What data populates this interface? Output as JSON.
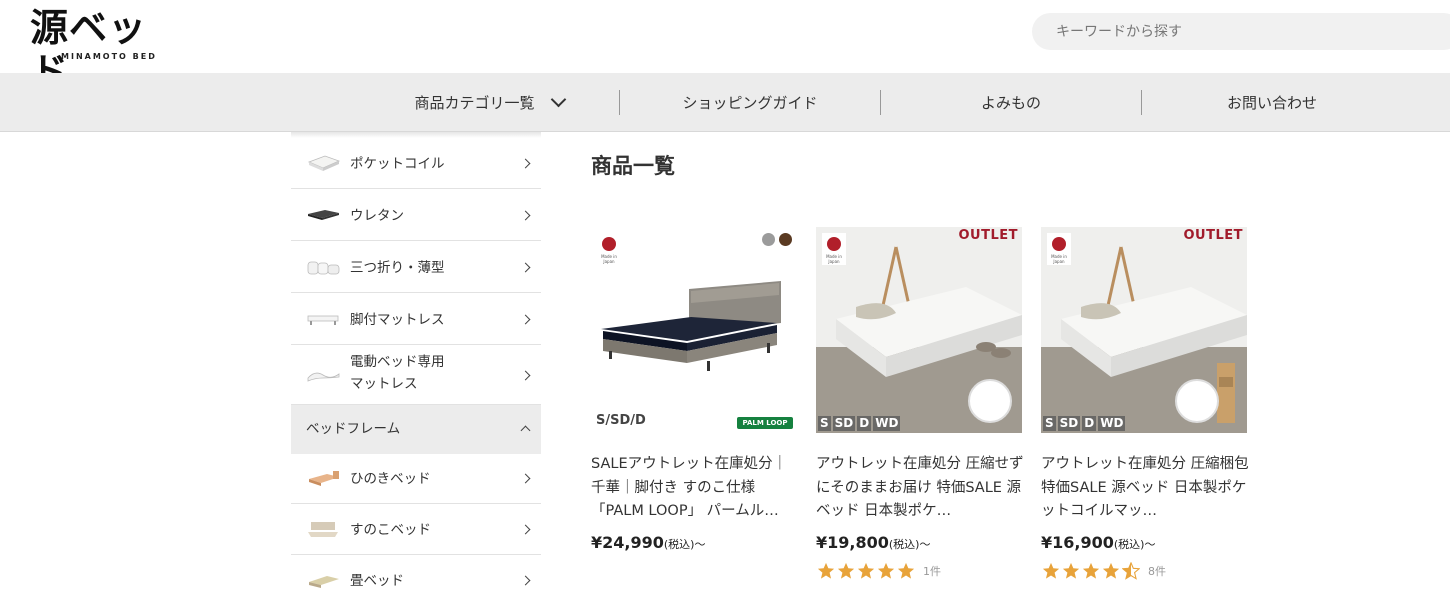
{
  "header": {
    "logo_main": "源ベッド",
    "logo_sub": "MINAMOTO BED",
    "search_placeholder": "キーワードから探す"
  },
  "nav": {
    "items": [
      {
        "label": "商品カテゴリ一覧"
      },
      {
        "label": "ショッピングガイド"
      },
      {
        "label": "よみもの"
      },
      {
        "label": "お問い合わせ"
      }
    ]
  },
  "sidebar": {
    "mattress_items": [
      {
        "label": "ポケットコイル"
      },
      {
        "label": "ウレタン"
      },
      {
        "label": "三つ折り・薄型"
      },
      {
        "label": "脚付マットレス"
      },
      {
        "label": "電動ベッド専用",
        "label2": "マットレス"
      }
    ],
    "frame_header": "ベッドフレーム",
    "frame_items": [
      {
        "label": "ひのきベッド"
      },
      {
        "label": "すのこベッド"
      },
      {
        "label": "畳ベッド"
      }
    ]
  },
  "main": {
    "title": "商品一覧",
    "products": [
      {
        "title": "SALEアウトレット在庫処分｜千華｜脚付き すのこ仕様「PALM LOOP」 パームル…",
        "price": "¥24,990",
        "price_tax": "(税込)〜",
        "sizes": "S/SD/D",
        "badge": "PALM LOOP",
        "swatch_colors": [
          "#9b9b9b",
          "#5a3a22"
        ]
      },
      {
        "title": "アウトレット在庫処分 圧縮せずにそのままお届け 特価SALE 源ベッド 日本製ポケ…",
        "price": "¥19,800",
        "price_tax": "(税込)〜",
        "outlet": "OUTLET",
        "size_tags": [
          "S",
          "SD",
          "D",
          "WD"
        ],
        "rating": 5,
        "review_count": "1件"
      },
      {
        "title": "アウトレット在庫処分 圧縮梱包 特価SALE 源ベッド 日本製ポケットコイルマッ…",
        "price": "¥16,900",
        "price_tax": "(税込)〜",
        "outlet": "OUTLET",
        "size_tags": [
          "S",
          "SD",
          "D",
          "WD"
        ],
        "rating": 4.5,
        "review_count": "8件"
      }
    ],
    "made_in_japan": "Made in Japan"
  },
  "colors": {
    "outlet": "#a11b2b",
    "star": "#e8a33a",
    "nav_bg": "#ececec",
    "palm_green": "#15813f"
  }
}
